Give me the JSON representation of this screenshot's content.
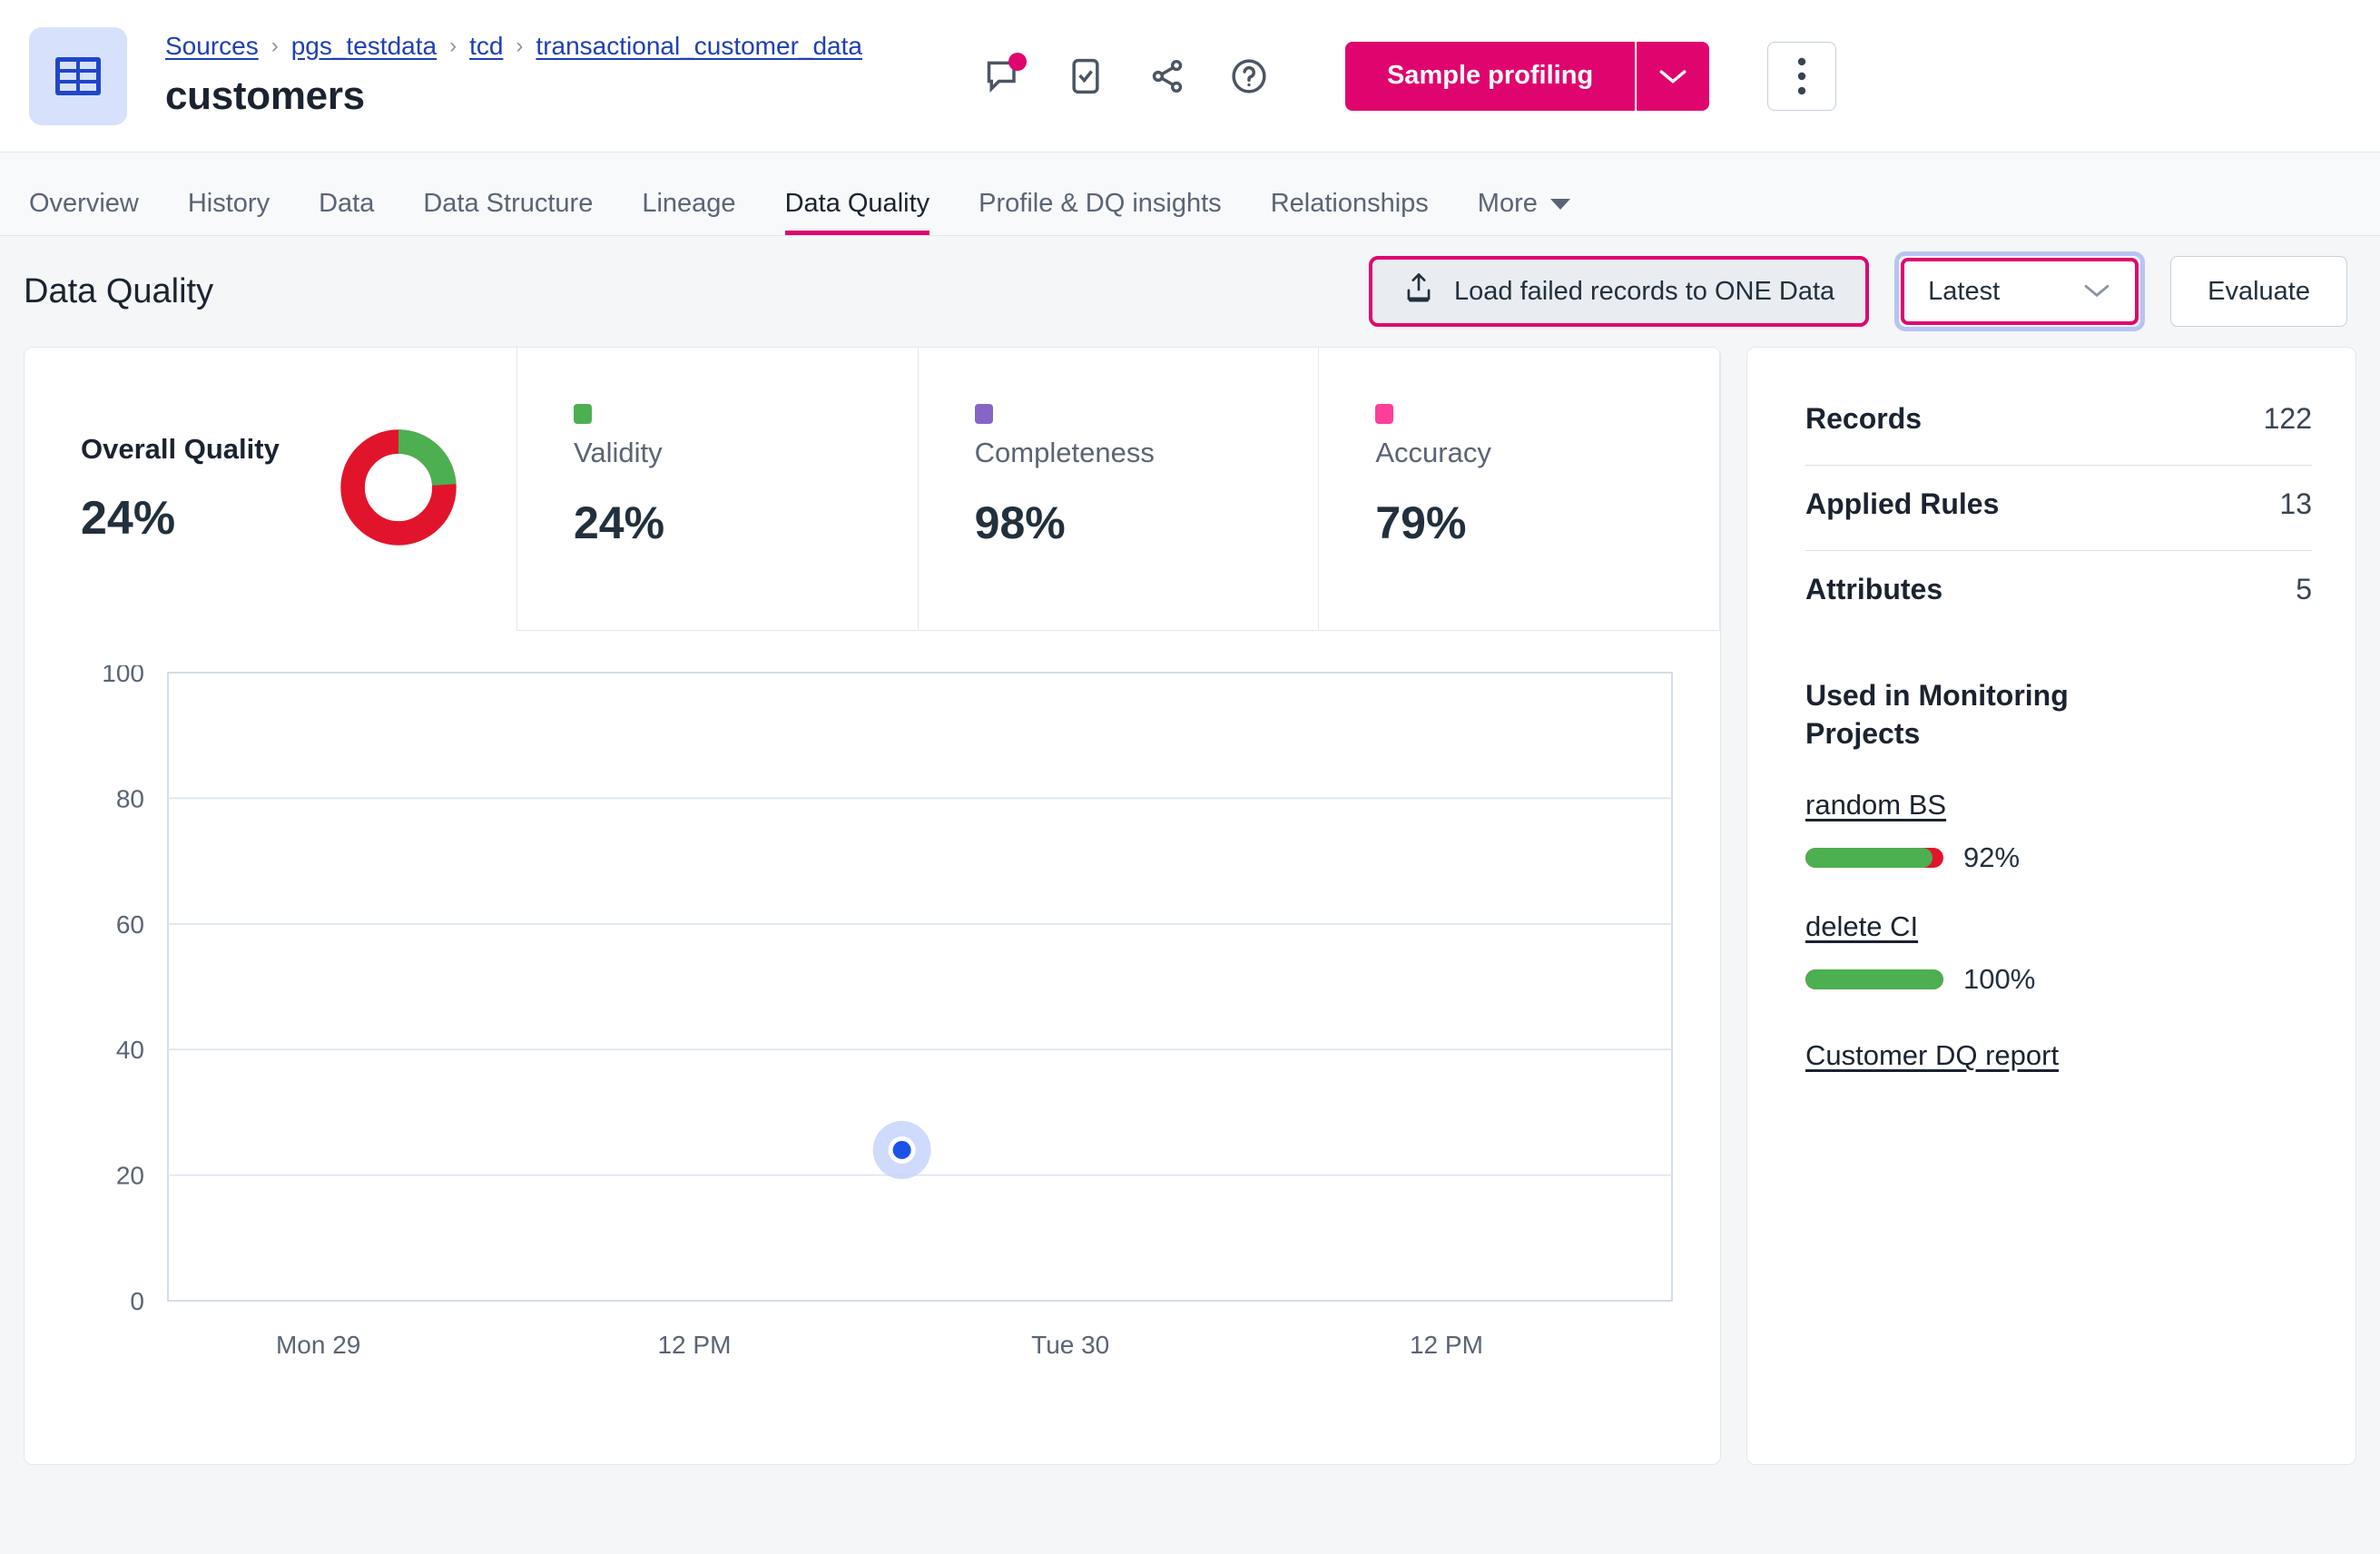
{
  "header": {
    "app_icon": "table-grid-icon",
    "breadcrumb": [
      "Sources",
      "pgs_testdata",
      "tcd",
      "transactional_customer_data"
    ],
    "breadcrumb_separator": "›",
    "title": "customers",
    "icons": [
      {
        "name": "comment-icon",
        "has_badge": true
      },
      {
        "name": "task-check-icon",
        "has_badge": false
      },
      {
        "name": "share-icon",
        "has_badge": false
      },
      {
        "name": "help-circle-icon",
        "has_badge": false
      }
    ],
    "primary_button": "Sample profiling",
    "primary_caret": "chevron-down-icon",
    "kebab": "more-vertical-icon"
  },
  "tabs": [
    {
      "label": "Overview",
      "active": false
    },
    {
      "label": "History",
      "active": false
    },
    {
      "label": "Data",
      "active": false
    },
    {
      "label": "Data Structure",
      "active": false
    },
    {
      "label": "Lineage",
      "active": false
    },
    {
      "label": "Data Quality",
      "active": true
    },
    {
      "label": "Profile & DQ insights",
      "active": false
    },
    {
      "label": "Relationships",
      "active": false
    },
    {
      "label": "More",
      "active": false
    }
  ],
  "toolbar": {
    "section_title": "Data Quality",
    "load_button": "Load failed records to ONE Data",
    "load_icon": "upload-icon",
    "latest_select_value": "Latest",
    "latest_caret": "chevron-down-icon",
    "evaluate_button": "Evaluate"
  },
  "metrics": {
    "overall": {
      "label": "Overall Quality",
      "value": "24%",
      "pct": 24,
      "good_color": "#4caf50",
      "bad_color": "#e2142c"
    },
    "cards": [
      {
        "label": "Validity",
        "value": "24%",
        "color": "#4caf50"
      },
      {
        "label": "Completeness",
        "value": "98%",
        "color": "#8765c8"
      },
      {
        "label": "Accuracy",
        "value": "79%",
        "color": "#ff3d9a"
      }
    ]
  },
  "chart_data": {
    "type": "scatter",
    "title": "",
    "xlabel": "",
    "ylabel": "",
    "ylim": [
      0,
      100
    ],
    "yticks": [
      0,
      20,
      40,
      60,
      80,
      100
    ],
    "ytick_labels": [
      "0",
      "20",
      "40",
      "60",
      "80",
      "100"
    ],
    "xtick_labels": [
      "Mon 29",
      "12 PM",
      "Tue 30",
      "12 PM"
    ],
    "xtick_positions": [
      0.1,
      0.35,
      0.6,
      0.85
    ],
    "grid": true,
    "series": [
      {
        "name": "Overall Quality",
        "point_color": "#1b53e8",
        "halo_color": "#c7d4fb",
        "points": [
          {
            "x": 0.488,
            "y": 24
          }
        ]
      }
    ]
  },
  "side_panel": {
    "stats": [
      {
        "name": "Records",
        "value": "122"
      },
      {
        "name": "Applied Rules",
        "value": "13"
      },
      {
        "name": "Attributes",
        "value": "5"
      }
    ],
    "monitoring_heading": "Used in Monitoring Projects",
    "projects": [
      {
        "name": "random BS",
        "pct_label": "92%",
        "pct": 92
      },
      {
        "name": "delete CI",
        "pct_label": "100%",
        "pct": 100
      }
    ],
    "report_link": "Customer DQ report"
  }
}
